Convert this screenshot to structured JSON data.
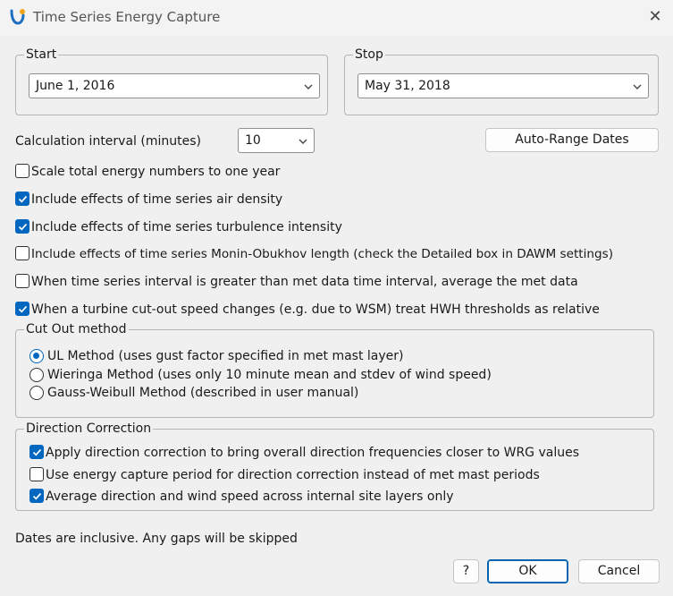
{
  "window": {
    "title": "Time Series Energy Capture",
    "close_icon": "close-icon"
  },
  "start": {
    "legend": "Start",
    "value": "June 1, 2016"
  },
  "stop": {
    "legend": "Stop",
    "value": "May 31, 2018"
  },
  "interval": {
    "label": "Calculation interval (minutes)",
    "value": "10"
  },
  "auto_range_label": "Auto-Range Dates",
  "options": [
    {
      "label": "Scale total energy numbers to one year",
      "checked": false
    },
    {
      "label": "Include effects of time series air density",
      "checked": true
    },
    {
      "label": "Include effects of time series turbulence intensity",
      "checked": true
    },
    {
      "label": "Include effects of time series Monin-Obukhov length (check the Detailed box in DAWM settings)",
      "checked": false
    },
    {
      "label": "When time series interval is greater than met data time interval, average the met data",
      "checked": false
    },
    {
      "label": "When a turbine cut-out speed changes (e.g. due to WSM) treat HWH thresholds as relative",
      "checked": true
    }
  ],
  "cutout": {
    "legend": "Cut Out method",
    "methods": [
      {
        "label": "UL Method (uses gust factor specified in met mast layer)",
        "selected": true
      },
      {
        "label": "Wieringa Method (uses only 10 minute mean and stdev of wind speed)",
        "selected": false
      },
      {
        "label": "Gauss-Weibull Method (described in user manual)",
        "selected": false
      }
    ]
  },
  "direction": {
    "legend": "Direction Correction",
    "options": [
      {
        "label": "Apply direction correction to bring overall direction frequencies closer to WRG values",
        "checked": true
      },
      {
        "label": "Use energy capture period for direction correction instead of met mast periods",
        "checked": false
      },
      {
        "label": "Average direction and wind speed across internal site layers only",
        "checked": true
      }
    ]
  },
  "footer_note": "Dates are inclusive. Any gaps will be skipped",
  "buttons": {
    "help": "?",
    "ok": "OK",
    "cancel": "Cancel"
  },
  "colors": {
    "accent": "#0067c0",
    "background": "#f0f0f0"
  }
}
